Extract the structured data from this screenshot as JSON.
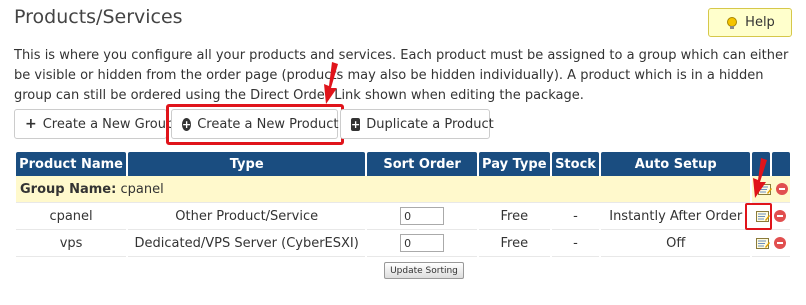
{
  "page": {
    "title": "Products/Services",
    "help_label": "Help",
    "description": "This is where you configure all your products and services. Each product must be assigned to a group which can either be visible or hidden from the order page (products may also be hidden individually). A product which is in a hidden group can still be ordered using the Direct Order Link shown when editing the package."
  },
  "toolbar": {
    "create_group_label": "Create a New Group",
    "create_product_label": "Create a New Product",
    "duplicate_product_label": "Duplicate a Product"
  },
  "table": {
    "headers": [
      "Product Name",
      "Type",
      "Sort Order",
      "Pay Type",
      "Stock",
      "Auto Setup",
      "",
      ""
    ],
    "group": {
      "label": "Group Name:",
      "name": "cpanel"
    },
    "rows": [
      {
        "name": "cpanel",
        "type": "Other Product/Service",
        "sort_order": "0",
        "pay_type": "Free",
        "stock": "-",
        "auto_setup": "Instantly After Order"
      },
      {
        "name": "vps",
        "type": "Dedicated/VPS Server (CyberESXI)",
        "sort_order": "0",
        "pay_type": "Free",
        "stock": "-",
        "auto_setup": "Off"
      }
    ]
  },
  "footer": {
    "update_sorting_label": "Update Sorting"
  },
  "colors": {
    "header_bg": "#1a4d80",
    "group_row_bg": "#fff9cc",
    "help_bg": "#ffffcc",
    "highlight_red": "#e0141b",
    "delete_red": "#e14f4f"
  },
  "icons": {
    "help": "lightbulb-icon",
    "create_group": "plus-icon",
    "create_product": "circle-plus-icon",
    "duplicate_product": "square-plus-icon",
    "edit": "edit-icon",
    "delete": "delete-icon",
    "annotation": "red-arrow-icon"
  }
}
